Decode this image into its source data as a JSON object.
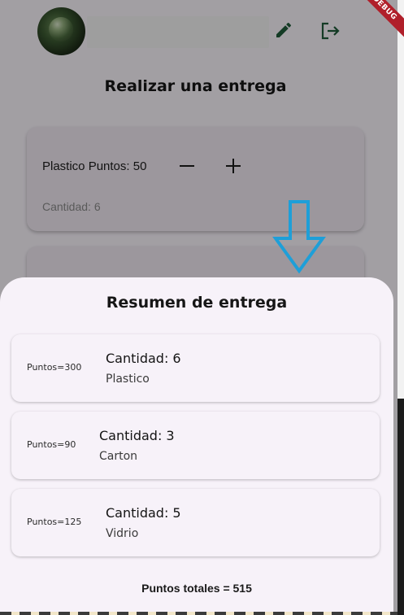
{
  "debug_banner": "DEBUG",
  "header": {
    "avatar": "profile-photo",
    "edit_icon": "pencil-icon",
    "logout_icon": "logout-icon"
  },
  "page": {
    "title": "Realizar una entrega",
    "product_card": {
      "label": "Plastico Puntos: 50",
      "quantity": "Cantidad: 6",
      "minus_icon": "minus-icon",
      "plus_icon": "plus-icon"
    }
  },
  "sheet": {
    "title": "Resumen de entrega",
    "items": [
      {
        "points": "Puntos=300",
        "quantity": "Cantidad: 6",
        "material": "Plastico"
      },
      {
        "points": "Puntos=90",
        "quantity": "Cantidad: 3",
        "material": "Carton"
      },
      {
        "points": "Puntos=125",
        "quantity": "Cantidad: 5",
        "material": "Vidrio"
      }
    ],
    "total": "Puntos totales = 515"
  },
  "colors": {
    "icon_green": "#1f5b3a",
    "arrow_blue": "#1e9fd8",
    "debug_red": "#b01f2a",
    "sheet_bg": "#f7f2f9"
  }
}
